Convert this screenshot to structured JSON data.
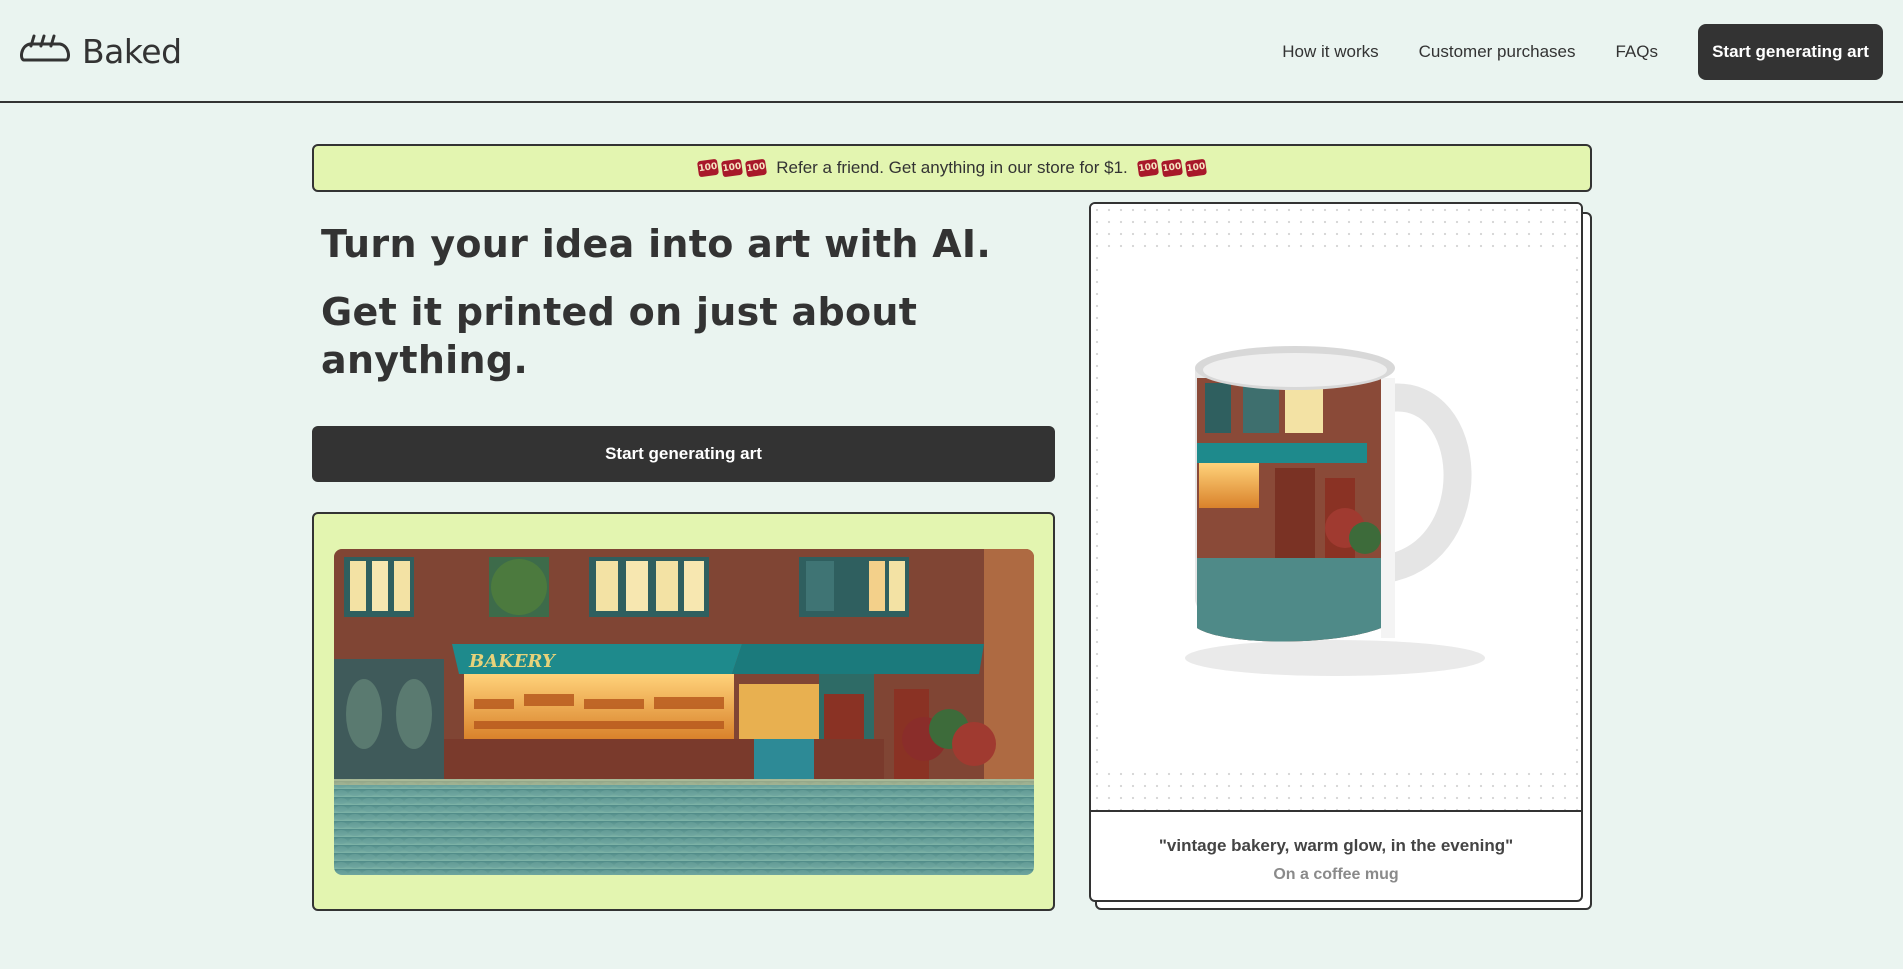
{
  "brand": {
    "name": "Baked",
    "logo_icon": "bread-icon"
  },
  "nav": {
    "links": [
      "How it works",
      "Customer purchases",
      "FAQs"
    ],
    "cta_label": "Start generating art"
  },
  "banner": {
    "text": "Refer a friend. Get anything in our store for $1.",
    "emoji_icon": "hundred-points-emoji",
    "emoji_glyph": "100"
  },
  "hero": {
    "line1": "Turn your idea into art with AI.",
    "line2": "Get it printed on just about anything.",
    "cta_label": "Start generating art"
  },
  "showcase": {
    "image_name": "vintage-bakery-scene",
    "sign_text": "BAKERY"
  },
  "product": {
    "prompt": "\"vintage bakery, warm glow, in the evening\"",
    "type": "On a coffee mug",
    "image_name": "coffee-mug-mockup"
  },
  "colors": {
    "background": "#eaf4f0",
    "dark": "#333333",
    "accent_green": "#e3f5b0",
    "awning_teal": "#1e8a8c"
  }
}
